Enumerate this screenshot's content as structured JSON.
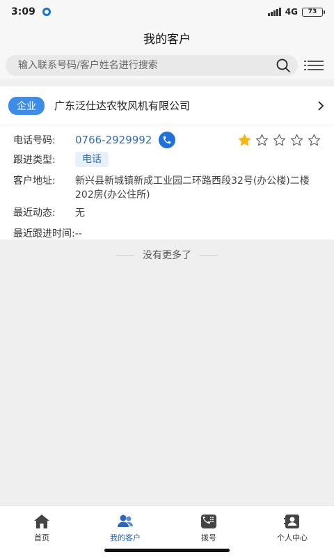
{
  "status_bar": {
    "time": "3:09",
    "network": "4G",
    "battery": "73"
  },
  "header": {
    "title": "我的客户"
  },
  "search": {
    "placeholder": "输入联系号码/客户姓名进行搜索"
  },
  "customer": {
    "type_badge": "企业",
    "company_name": "广东泛仕达农牧风机有限公司",
    "phone_label": "电话号码:",
    "phone_number": "0766-2929992",
    "rating": 1,
    "rating_max": 5,
    "followup_type_label": "跟进类型:",
    "followup_type": "电话",
    "address_label": "客户地址:",
    "address": "新兴县新城镇新成工业园二环路西段32号(办公楼)二楼202房(办公住所)",
    "recent_activity_label": "最近动态:",
    "recent_activity": "无",
    "last_followup_label": "最近跟进时间:",
    "last_followup": "--"
  },
  "list_footer": {
    "no_more": "没有更多了"
  },
  "tabs": [
    {
      "label": "首页",
      "icon": "home-icon",
      "active": false
    },
    {
      "label": "我的客户",
      "icon": "customers-icon",
      "active": true
    },
    {
      "label": "拨号",
      "icon": "dialpad-icon",
      "active": false
    },
    {
      "label": "个人中心",
      "icon": "profile-icon",
      "active": false
    }
  ],
  "colors": {
    "accent": "#3d8de6",
    "active_tab": "#2a66b3",
    "star": "#f2b51b"
  }
}
